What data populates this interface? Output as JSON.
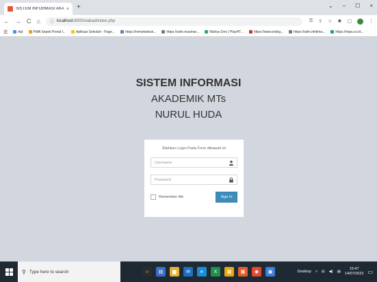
{
  "browser": {
    "tab_title": "SISTEM INFORMASI AKADEMIK M",
    "tab_close": "×",
    "new_tab": "+",
    "window_controls": [
      "⌄",
      "–",
      "☐",
      "×"
    ],
    "nav": {
      "back": "←",
      "forward": "→",
      "reload": "C",
      "home": "⌂"
    },
    "url_host": "localhost",
    "url_path": ":8000/siakad/index.php",
    "bookmarks": [
      {
        "label": "Apl",
        "color": "#4a8af4"
      },
      {
        "label": "PdfA Sepeti Portal f...",
        "color": "#f39c12"
      },
      {
        "label": "Aplikasi Sekolah - Page...",
        "color": "#f1c40f"
      },
      {
        "label": "https://remotedesk...",
        "color": "#5b7ec7"
      },
      {
        "label": "https://sdm.masmar...",
        "color": "#7a7a7a"
      },
      {
        "label": "Wahyu Dev | PlayHT...",
        "color": "#27ae60"
      },
      {
        "label": "https://www.indog...",
        "color": "#c0392b"
      },
      {
        "label": "https://sdm.mhlima...",
        "color": "#7a7a7a"
      },
      {
        "label": "https://mpa.co.id...",
        "color": "#16a085"
      }
    ]
  },
  "page": {
    "title_line1": "SISTEM INFORMASI",
    "title_line2": "AKADEMIK MTs",
    "title_line3": "NURUL HUDA",
    "login": {
      "message": "Silahkan Login Pada Form dibawah ini",
      "username_placeholder": "Username",
      "password_placeholder": "Password",
      "remember_label": "Remember Me",
      "signin_label": "Sign In"
    }
  },
  "taskbar": {
    "search_placeholder": "Type here to search",
    "desktop_label": "Desktop",
    "time": "15:47",
    "date": "14/07/2022",
    "task_icons": [
      {
        "name": "cortana-icon",
        "color": "#2b2b2b",
        "glyph": "○"
      },
      {
        "name": "task-view-icon",
        "color": "#3a6fc4",
        "glyph": "▤"
      },
      {
        "name": "file-explorer-icon",
        "color": "#e8b030",
        "glyph": "▆"
      },
      {
        "name": "mail-icon",
        "color": "#1e6fc4",
        "glyph": "✉"
      },
      {
        "name": "edge-icon",
        "color": "#1a8cd8",
        "glyph": "e"
      },
      {
        "name": "excel-icon",
        "color": "#1f8f4a",
        "glyph": "X"
      },
      {
        "name": "app-yellow-icon",
        "color": "#e6a817",
        "glyph": "▦"
      },
      {
        "name": "app-orange-icon",
        "color": "#e85a2a",
        "glyph": "▦"
      },
      {
        "name": "chrome-icon",
        "color": "#e0482f",
        "glyph": "◉"
      },
      {
        "name": "app-blue-icon",
        "color": "#3b7dd8",
        "glyph": "▣"
      }
    ]
  },
  "colors": {
    "page_bg": "#d2d6de",
    "button_primary": "#3c8dbc",
    "taskbar_bg": "#1f2933"
  }
}
